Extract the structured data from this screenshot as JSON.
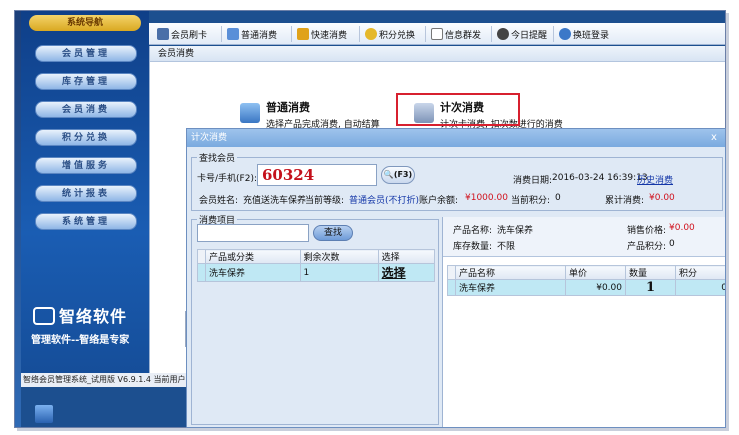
{
  "sidebar": {
    "title": "系统导航",
    "items": [
      "会员管理",
      "库存管理",
      "会员消费",
      "积分兑换",
      "增值服务",
      "统计报表",
      "系统管理"
    ]
  },
  "toolbar": {
    "items": [
      "会员刷卡",
      "普通消费",
      "快速消费",
      "积分兑换",
      "信息群发",
      "今日提醒",
      "换班登录"
    ]
  },
  "main": {
    "header": "会员消费",
    "normal": {
      "title": "普通消费",
      "desc": "选择产品完成消费, 自动结算"
    },
    "count": {
      "title": "计次消费",
      "desc": "计次卡消费, 扣次数进行的消费"
    }
  },
  "logo": {
    "name": "智络软件",
    "slogan": "管理软件--智络是专家"
  },
  "statusbar": {
    "text": "智络会员管理系统_试用版 V6.9.1.4  当前用户"
  },
  "dialog": {
    "title": "计次消费",
    "close": "x",
    "lookup": {
      "group": "查找会员",
      "card_label": "卡号/手机(F2):",
      "card_value": "60324",
      "f3_label": "(F3)",
      "date_label": "消费日期:",
      "date_value": "2016-03-24 16:39:13",
      "history_link": "历史消费",
      "name_label": "会员姓名:",
      "name_value": "充值送洗车保养",
      "level_label": "当前等级:",
      "level_value": "普通会员(不打折)",
      "balance_label": "账户余额:",
      "balance_value": "¥1000.00",
      "points_label": "当前积分:",
      "points_value": "0",
      "total_label": "累计消费:",
      "total_value": "¥0.00"
    },
    "items": {
      "group": "消费项目",
      "search_button": "查找",
      "columns": [
        "产品或分类",
        "剩余次数",
        "选择"
      ],
      "rows": [
        {
          "name": "洗车保养",
          "remaining": "1",
          "select": "选择"
        }
      ]
    },
    "product": {
      "name_label": "产品名称:",
      "name_value": "洗车保养",
      "price_label": "销售价格:",
      "price_value": "¥0.00",
      "stock_label": "库存数量:",
      "stock_value": "不限",
      "points_label": "产品积分:",
      "points_value": "0",
      "columns": [
        "产品名称",
        "单价",
        "数量",
        "积分"
      ],
      "rows": [
        {
          "name": "洗车保养",
          "price": "¥0.00",
          "qty": "1",
          "points": "0"
        }
      ]
    }
  },
  "colors": {
    "accent_red": "#d7202f",
    "nav_blue": "#1a5db3",
    "selected_row": "#bfe8f4"
  }
}
